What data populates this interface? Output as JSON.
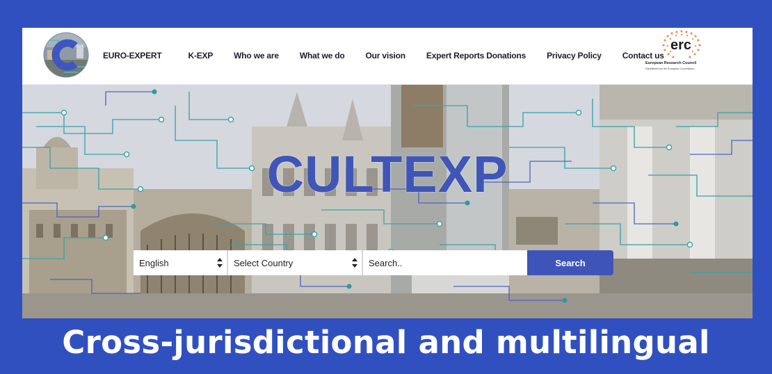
{
  "colors": {
    "border": "#3150c0",
    "accent": "#3e54b8",
    "title": "#3f56b8",
    "circuit": "#3aa3a8"
  },
  "header": {
    "logo_icon": "cultexp-c-logo-icon",
    "nav": [
      {
        "label": "EURO-EXPERT",
        "name": "nav-euro-expert"
      },
      {
        "label": "K-EXP",
        "name": "nav-k-exp"
      },
      {
        "label": "Who we are",
        "name": "nav-who-we-are"
      },
      {
        "label": "What we do",
        "name": "nav-what-we-do"
      },
      {
        "label": "Our vision",
        "name": "nav-our-vision"
      },
      {
        "label": "Expert Reports Donations",
        "name": "nav-expert-reports-donations"
      },
      {
        "label": "Privacy Policy",
        "name": "nav-privacy-policy"
      },
      {
        "label": "Contact us",
        "name": "nav-contact-us"
      }
    ],
    "erc": {
      "mark": "erc",
      "title": "European Research Council",
      "subtitle": "Established by the European Commission"
    }
  },
  "hero": {
    "title": "CULTEXP",
    "language_select": {
      "value": "English",
      "icon": "select-arrows-icon"
    },
    "country_select": {
      "value": "Select Country",
      "icon": "select-arrows-icon"
    },
    "search": {
      "placeholder": "Search..",
      "button_label": "Search"
    }
  },
  "caption": "Cross-jurisdictional and multilingual"
}
